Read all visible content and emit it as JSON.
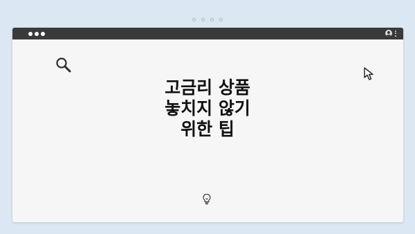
{
  "pager": {
    "dots": 4
  },
  "window": {
    "titlebar_color": "#3a3a3a",
    "background_color": "#f6f6f6",
    "icons": {
      "window_controls": "three-dots-icon",
      "profile": "user-profile-icon",
      "menu": "kebab-menu-icon"
    }
  },
  "page": {
    "background_color": "#dbe7f3",
    "headline": {
      "line1": "고금리 상품",
      "line2": "놓치지 않기",
      "line3": "위한 팁"
    },
    "icons": {
      "search": "magnifier-icon",
      "cursor": "mouse-pointer-icon",
      "idea": "lightbulb-icon"
    }
  }
}
